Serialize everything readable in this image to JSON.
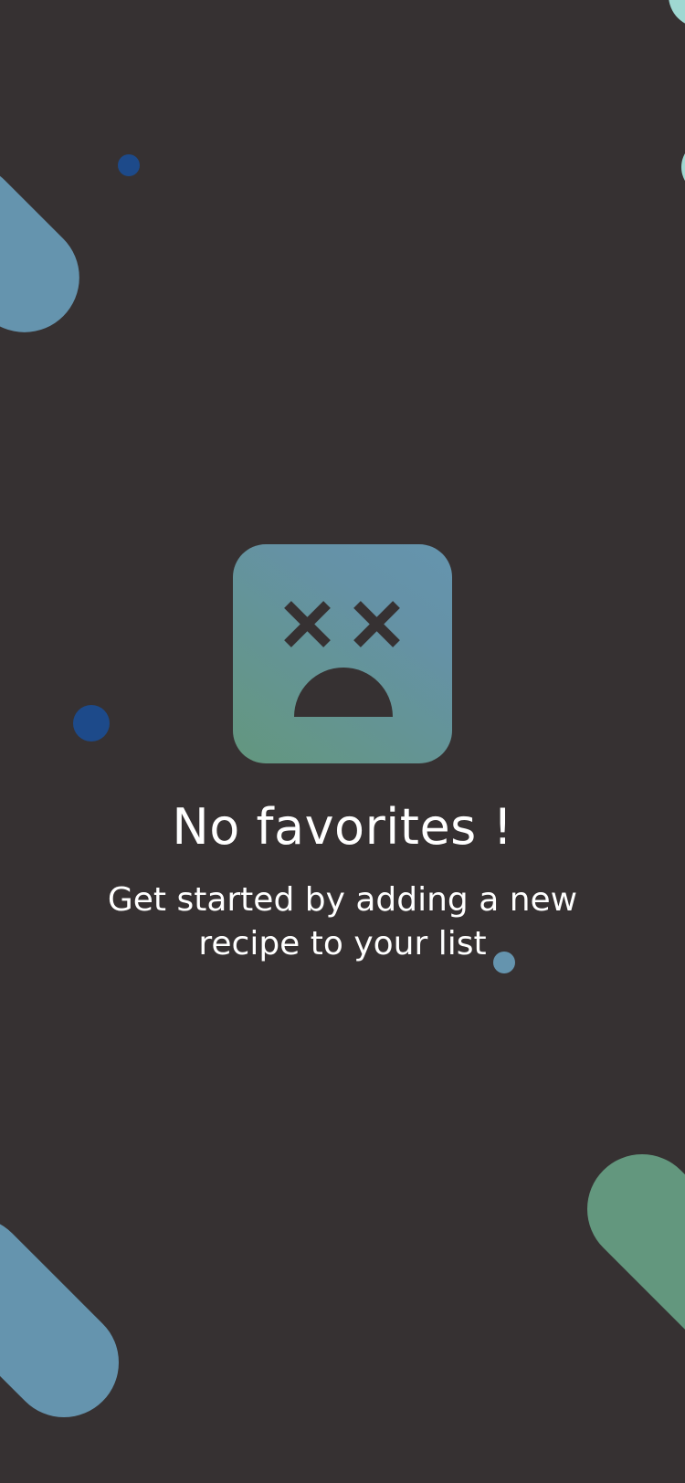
{
  "empty_state": {
    "icon": "dead-face-icon",
    "title": "No favorites !",
    "subtitle": "Get started by adding a new recipe to your list"
  },
  "colors": {
    "background": "#363132",
    "accent_teal": "#6594ae",
    "accent_green": "#63977e",
    "accent_blue": "#1d4a8a",
    "mint": "#9fd8d2"
  }
}
